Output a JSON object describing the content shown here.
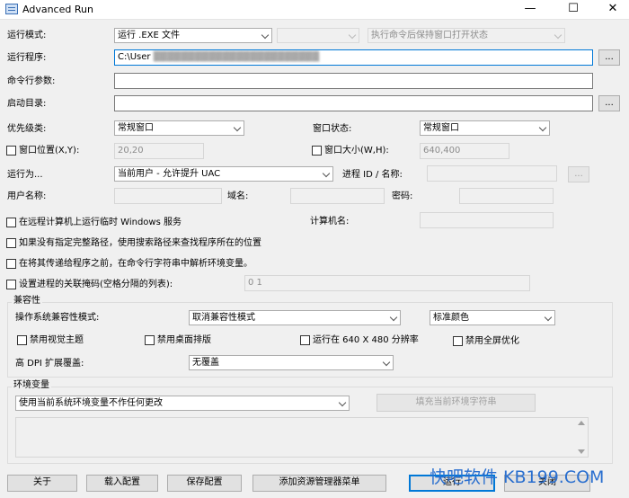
{
  "window": {
    "title": "Advanced Run",
    "minimize": "—",
    "maximize": "☐",
    "close": "✕"
  },
  "run_mode": {
    "label": "运行模式:",
    "value": "运行 .EXE 文件",
    "secondary_value": "",
    "keep_window_value": "执行命令后保持窗口打开状态"
  },
  "program": {
    "label": "运行程序:",
    "value": "C:\\User",
    "browse": "..."
  },
  "args": {
    "label": "命令行参数:",
    "value": ""
  },
  "start_dir": {
    "label": "启动目录:",
    "value": "",
    "browse": "..."
  },
  "priority": {
    "label": "优先级类:",
    "value": "常规窗口"
  },
  "window_state": {
    "label": "窗口状态:",
    "value": "常规窗口"
  },
  "window_pos": {
    "label": "窗口位置(X,Y):",
    "value": "20,20"
  },
  "window_size": {
    "label": "窗口大小(W,H):",
    "value": "640,400"
  },
  "run_as": {
    "label": "运行为...",
    "value": "当前用户 - 允许提升 UAC",
    "process_label": "进程 ID / 名称:",
    "process_value": "",
    "browse": "..."
  },
  "credentials": {
    "user_label": "用户名称:",
    "domain_label": "域名:",
    "password_label": "密码:"
  },
  "options": {
    "remote_service": "在远程计算机上运行临时 Windows 服务",
    "computer_label": "计算机名:",
    "search_path": "如果没有指定完整路径，使用搜索路径来查找程序所在的位置",
    "parse_env": "在将其传递给程序之前，在命令行字符串中解析环境变量。",
    "affinity": "设置进程的关联掩码(空格分隔的列表):",
    "affinity_value": "0 1"
  },
  "compat": {
    "group_title": "兼容性",
    "os_label": "操作系统兼容性模式:",
    "os_value": "取消兼容性模式",
    "color_value": "标准颜色",
    "disable_visual_themes": "禁用视觉主题",
    "disable_desktop_composition": "禁用桌面排版",
    "run_640x480": "运行在 640 X 480 分辨率",
    "disable_fullscreen_opt": "禁用全屏优化",
    "dpi_label": "高 DPI 扩展覆盖:",
    "dpi_value": "无覆盖"
  },
  "env": {
    "group_title": "环境变量",
    "value": "使用当前系统环境变量不作任何更改",
    "fill_button": "填充当前环境字符串"
  },
  "footer": {
    "about": "关于",
    "load": "载入配置",
    "save": "保存配置",
    "explorer_menu": "添加资源管理器菜单",
    "run": "运行",
    "close": "关闭"
  },
  "watermark": "快吧软件 KB199.COM"
}
